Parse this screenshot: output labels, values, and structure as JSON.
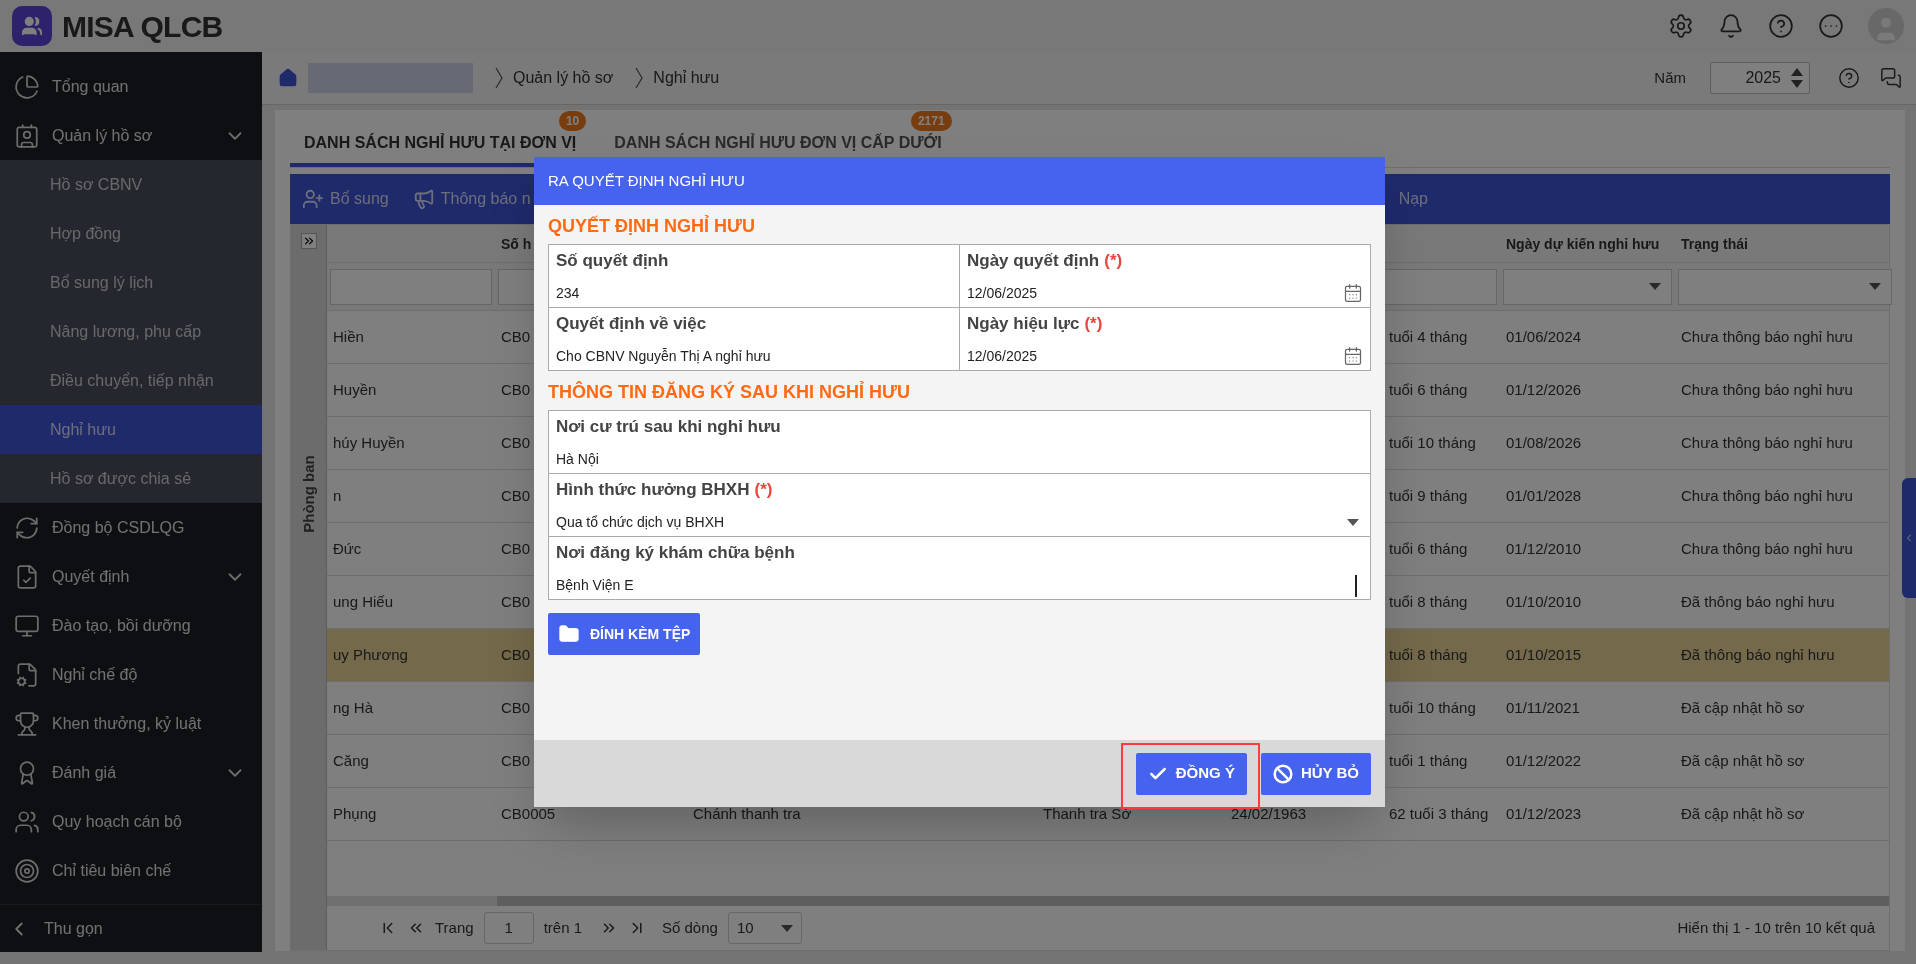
{
  "app": {
    "title": "MISA QLCB"
  },
  "sidebar": {
    "items": [
      {
        "label": "Tổng quan",
        "has_submenu": false
      },
      {
        "label": "Quản lý hồ sơ",
        "has_submenu": true,
        "children": [
          {
            "label": "Hồ sơ CBNV",
            "selected": false
          },
          {
            "label": "Hợp đồng",
            "selected": false
          },
          {
            "label": "Bổ sung lý lịch",
            "selected": false
          },
          {
            "label": "Nâng lương, phụ cấp",
            "selected": false
          },
          {
            "label": "Điều chuyển, tiếp nhận",
            "selected": false
          },
          {
            "label": "Nghỉ hưu",
            "selected": true
          },
          {
            "label": "Hồ sơ được chia sẻ",
            "selected": false
          }
        ]
      },
      {
        "label": "Đồng bộ CSDLQG",
        "has_submenu": false
      },
      {
        "label": "Quyết định",
        "has_submenu": true
      },
      {
        "label": "Đào tạo, bồi dưỡng",
        "has_submenu": false
      },
      {
        "label": "Nghỉ chế độ",
        "has_submenu": false
      },
      {
        "label": "Khen thưởng, kỷ luật",
        "has_submenu": false
      },
      {
        "label": "Đánh giá",
        "has_submenu": true
      },
      {
        "label": "Quy hoạch cán bộ",
        "has_submenu": false
      },
      {
        "label": "Chỉ tiêu biên chế",
        "has_submenu": false
      }
    ],
    "collapse_label": "Thu gọn"
  },
  "breadcrumb": {
    "items": [
      "Quản lý hồ sơ",
      "Nghỉ hưu"
    ]
  },
  "year": {
    "label": "Năm",
    "value": "2025"
  },
  "tabs": [
    {
      "label": "DANH SÁCH NGHỈ HƯU TẠI ĐƠN VỊ",
      "badge": "10",
      "selected": true
    },
    {
      "label": "DANH SÁCH NGHỈ HƯU ĐƠN VỊ CẤP DƯỚI",
      "badge": "2171",
      "selected": false
    }
  ],
  "toolbar": {
    "buttons": [
      "Bổ sung",
      "Thông báo n"
    ],
    "right_buttons": [
      "Nạp"
    ]
  },
  "side_panel": {
    "label": "Phòng ban"
  },
  "table": {
    "columns": [
      {
        "kind": "text_filter"
      },
      {
        "header": "Số h",
        "kind": "text_filter"
      },
      {
        "kind": "plain"
      },
      {
        "kind": "plain"
      },
      {
        "kind": "plain"
      },
      {
        "kind": "text_filter"
      },
      {
        "header": "Ngày dự kiến nghỉ hưu",
        "kind": "select_filter"
      },
      {
        "header": "Trạng thái",
        "kind": "select_filter"
      }
    ],
    "rows": [
      {
        "name": "Hiền",
        "code": "CB0",
        "age": "tuổi 4 tháng",
        "expected_date": "01/06/2024",
        "status": "Chưa thông báo nghỉ hưu",
        "selected": false
      },
      {
        "name": "Huyền",
        "code": "CB0",
        "age": "tuổi 6 tháng",
        "expected_date": "01/12/2026",
        "status": "Chưa thông báo nghỉ hưu",
        "selected": false
      },
      {
        "name": "húy Huyền",
        "code": "CB0",
        "age": "tuổi 10 tháng",
        "expected_date": "01/08/2026",
        "status": "Chưa thông báo nghỉ hưu",
        "selected": false
      },
      {
        "name": "n",
        "code": "CB0",
        "age": "tuổi 9 tháng",
        "expected_date": "01/01/2028",
        "status": "Chưa thông báo nghỉ hưu",
        "selected": false
      },
      {
        "name": "Đức",
        "code": "CB0",
        "age": "tuổi 6 tháng",
        "expected_date": "01/12/2010",
        "status": "Chưa thông báo nghỉ hưu",
        "selected": false
      },
      {
        "name": "ung Hiếu",
        "code": "CB0",
        "age": "tuổi 8 tháng",
        "expected_date": "01/10/2010",
        "status": "Đã thông báo nghỉ hưu",
        "selected": false
      },
      {
        "name": "uy Phương",
        "code": "CB0",
        "age": "tuổi 8 tháng",
        "expected_date": "01/10/2015",
        "status": "Đã thông báo nghỉ hưu",
        "selected": true
      },
      {
        "name": "ng Hà",
        "code": "CB0",
        "age": "tuổi 10 tháng",
        "expected_date": "01/11/2021",
        "status": "Đã cập nhật hồ sơ",
        "selected": false
      },
      {
        "name": "Căng",
        "code": "CB0",
        "age": "tuổi 1 tháng",
        "expected_date": "01/12/2022",
        "status": "Đã cập nhật hồ sơ",
        "selected": false
      },
      {
        "name": "Phụng",
        "code": "CB0005",
        "position": "Chánh thanh tra",
        "department": "Thanh tra Sở",
        "birth_date": "24/02/1963",
        "age": "62 tuổi 3 tháng",
        "expected_date": "01/12/2023",
        "status": "Đã cập nhật hồ sơ",
        "selected": false
      }
    ]
  },
  "pagination": {
    "page_label": "Trang",
    "page": "1",
    "of_label": "trên 1",
    "rows_label": "Số dòng",
    "rows_value": "10",
    "summary": "Hiển thị 1 - 10 trên 10 kết quả"
  },
  "dialog": {
    "title": "RA QUYẾT ĐỊNH NGHỈ HƯU",
    "sections": [
      {
        "heading": "QUYẾT ĐỊNH NGHỈ HƯU",
        "fields": [
          {
            "label": "Số quyết định",
            "required": false,
            "value": "234",
            "kind": "text",
            "focused": false
          },
          {
            "label": "Ngày quyết định",
            "required": true,
            "value": "12/06/2025",
            "kind": "date",
            "focused": false
          },
          {
            "label": "Quyết định về việc",
            "required": false,
            "value": "Cho CBNV Nguyễn Thị A nghỉ hưu",
            "kind": "text",
            "focused": false
          },
          {
            "label": "Ngày hiệu lực",
            "required": true,
            "value": "12/06/2025",
            "kind": "date",
            "focused": false
          }
        ]
      },
      {
        "heading": "THÔNG TIN ĐĂNG KÝ SAU KHI NGHỈ HƯU",
        "fields": [
          {
            "label": "Nơi cư trú sau khi nghỉ hưu",
            "required": false,
            "value": "Hà Nội",
            "kind": "text",
            "focused": false
          },
          {
            "label": "Hình thức hưởng BHXH",
            "required": true,
            "value": "Qua tổ chức dịch vụ BHXH",
            "kind": "select",
            "focused": false
          },
          {
            "label": "Nơi đăng ký khám chữa bệnh",
            "required": false,
            "value": "Bệnh Viện E",
            "kind": "text",
            "focused": true
          }
        ]
      }
    ],
    "required_mark": "(*)",
    "attach_button": "ĐÍNH KÈM TỆP",
    "buttons": [
      {
        "label": "ĐỒNG Ý",
        "kind": "confirm",
        "highlighted": true
      },
      {
        "label": "HỦY BỎ",
        "kind": "cancel",
        "highlighted": false
      }
    ]
  }
}
